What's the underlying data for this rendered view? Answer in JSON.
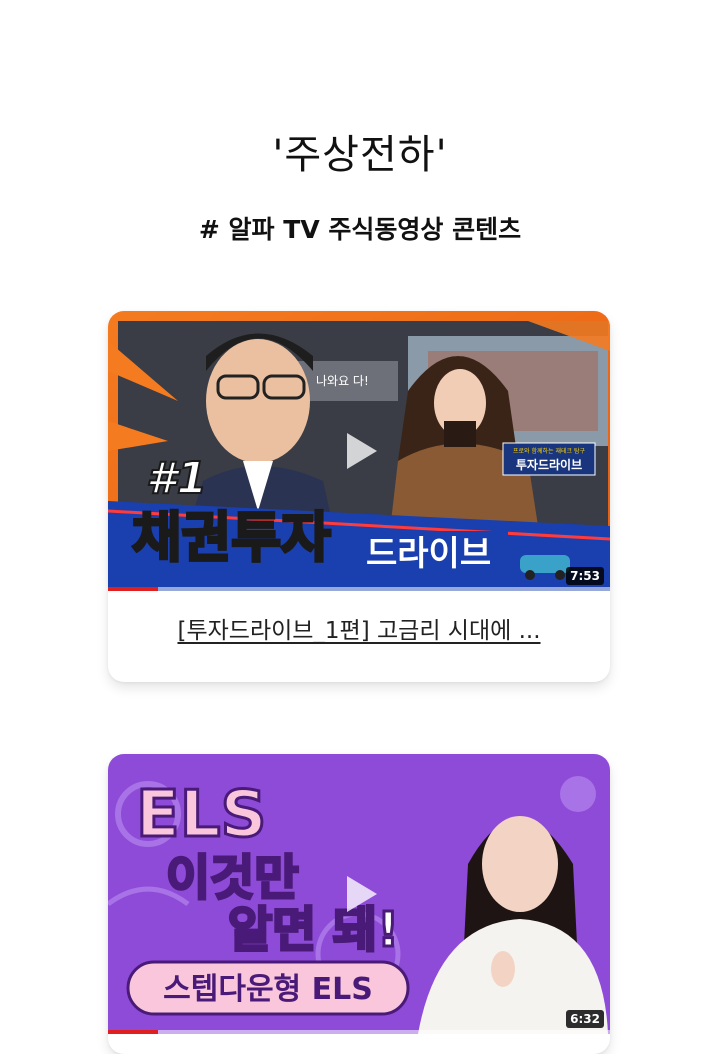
{
  "header": {
    "title": "'주상전하'",
    "subtitle": "# 알파 TV 주식동영상 콘텐츠"
  },
  "videos": [
    {
      "title": "[투자드라이브_1편] 고금리 시대에 ...",
      "duration": "7:53",
      "progress": 0.1,
      "thumbnail": {
        "episode": "#1",
        "headline": "채권투자",
        "sub": "드라이브",
        "caption": "나와요 다!",
        "badge_small": "프로와 함께하는 재테크 탐구",
        "badge": "투자드라이브"
      }
    },
    {
      "title": "",
      "duration": "6:32",
      "progress": 0.1,
      "thumbnail": {
        "line1": "ELS",
        "line2": "이것만",
        "line3": "알면 돼!",
        "banner": "스텝다운형 ELS"
      }
    }
  ],
  "colors": {
    "accent_red": "#e02020",
    "thumb1_orange": "#f47b20",
    "thumb1_blue": "#1a3fae",
    "thumb2_purple": "#8e4bd8",
    "thumb2_pink": "#f9c6dc"
  }
}
